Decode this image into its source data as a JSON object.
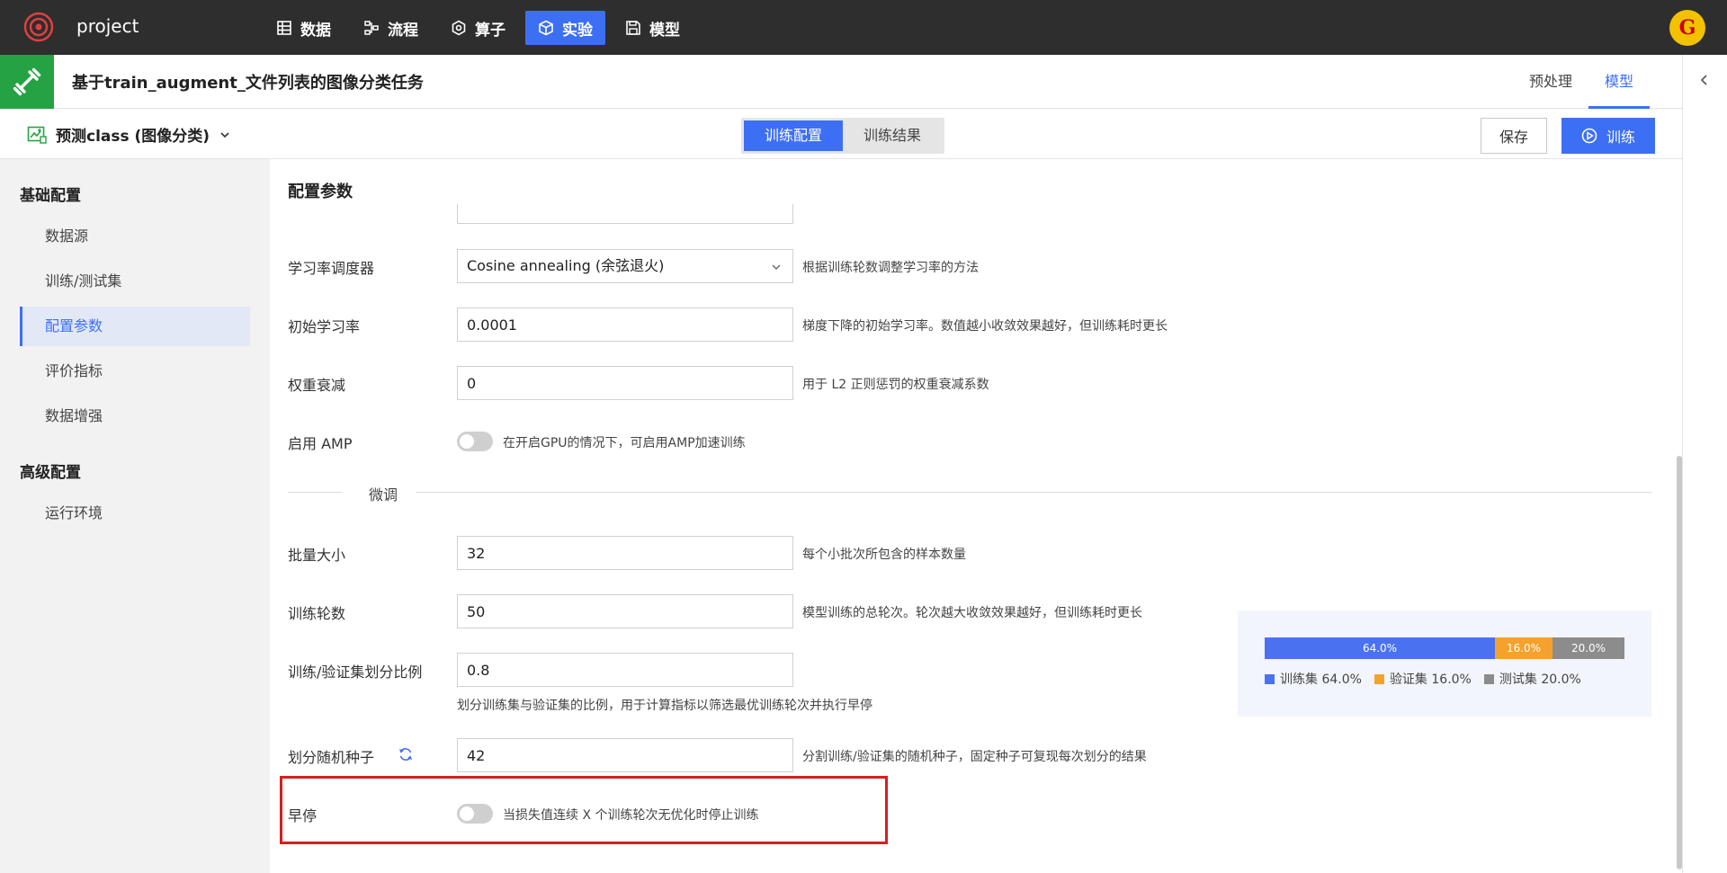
{
  "app": {
    "project_name": "project",
    "avatar_letter": "G"
  },
  "nav": {
    "items": [
      {
        "label": "数据"
      },
      {
        "label": "流程"
      },
      {
        "label": "算子"
      },
      {
        "label": "实验"
      },
      {
        "label": "模型"
      }
    ],
    "active": "实验"
  },
  "task": {
    "title": "基于train_augment_文件列表的图像分类任务",
    "step_tabs": [
      "预处理",
      "模型"
    ],
    "active_step": "模型"
  },
  "toolbar": {
    "model_select": "预测class (图像分类)",
    "view_tabs": [
      "训练配置",
      "训练结果"
    ],
    "active_view": "训练配置",
    "save_label": "保存",
    "train_label": "训练"
  },
  "sidebar": {
    "groups": [
      {
        "title": "基础配置",
        "items": [
          "数据源",
          "训练/测试集",
          "配置参数",
          "评价指标",
          "数据增强"
        ]
      },
      {
        "title": "高级配置",
        "items": [
          "运行环境"
        ]
      }
    ],
    "active_item": "配置参数"
  },
  "main": {
    "section_title": "配置参数",
    "fields": {
      "lr_scheduler": {
        "label": "学习率调度器",
        "value": "Cosine annealing (余弦退火)",
        "hint": "根据训练轮数调整学习率的方法"
      },
      "initial_lr": {
        "label": "初始学习率",
        "value": "0.0001",
        "hint": "梯度下降的初始学习率。数值越小收敛效果越好，但训练耗时更长"
      },
      "weight_decay": {
        "label": "权重衰减",
        "value": "0",
        "hint": "用于 L2 正则惩罚的权重衰减系数"
      },
      "amp": {
        "label": "启用 AMP",
        "enabled": false,
        "hint": "在开启GPU的情况下，可启用AMP加速训练"
      },
      "divider": {
        "label": "微调"
      },
      "batch_size": {
        "label": "批量大小",
        "value": "32",
        "hint": "每个小批次所包含的样本数量"
      },
      "epochs": {
        "label": "训练轮数",
        "value": "50",
        "hint": "模型训练的总轮次。轮次越大收敛效果越好，但训练耗时更长"
      },
      "split_ratio": {
        "label": "训练/验证集划分比例",
        "value": "0.8",
        "hint": "划分训练集与验证集的比例，用于计算指标以筛选最优训练轮次并执行早停"
      },
      "split_seed": {
        "label": "划分随机种子",
        "value": "42",
        "hint": "分割训练/验证集的随机种子，固定种子可复现每次划分的结果"
      },
      "early_stop": {
        "label": "早停",
        "enabled": false,
        "hint": "当损失值连续 X 个训练轮次无优化时停止训练"
      }
    },
    "split_chart": {
      "segments": [
        {
          "label": "64.0%",
          "percent": 64.0,
          "color": "#4a72f0"
        },
        {
          "label": "16.0%",
          "percent": 16.0,
          "color": "#f4a22d"
        },
        {
          "label": "20.0%",
          "percent": 20.0,
          "color": "#8c8c8c"
        }
      ],
      "legend": [
        {
          "name": "训练集 64.0%",
          "color": "#4a72f0"
        },
        {
          "name": "验证集 16.0%",
          "color": "#f4a22d"
        },
        {
          "name": "测试集 20.0%",
          "color": "#8c8c8c"
        }
      ]
    }
  }
}
